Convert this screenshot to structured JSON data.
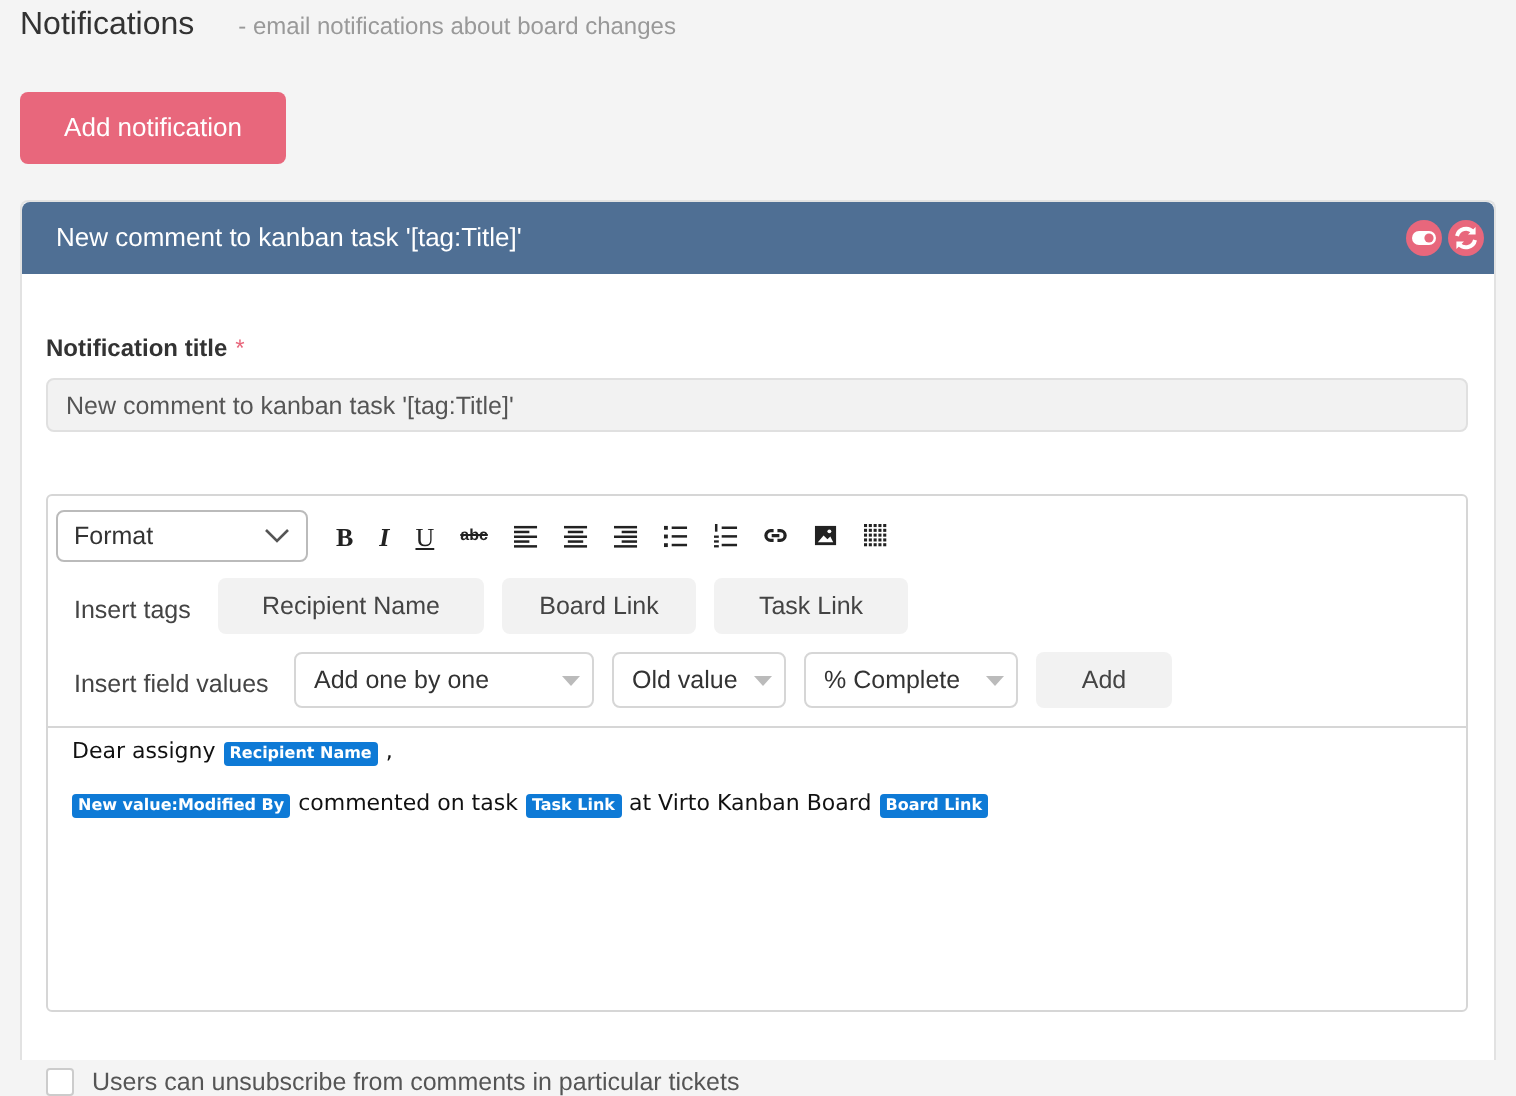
{
  "page": {
    "title": "Notifications",
    "subtitle": "- email notifications about board changes"
  },
  "add_button": "Add notification",
  "panel": {
    "title": "New comment to kanban task '[tag:Title]'",
    "title_field": {
      "label": "Notification title",
      "required_mark": "*",
      "value": "New comment to kanban task '[tag:Title]'"
    },
    "editor": {
      "format_select": "Format",
      "toolbar": [
        {
          "kind": "bold",
          "text": "B"
        },
        {
          "kind": "italic",
          "text": "I"
        },
        {
          "kind": "underline",
          "text": "U"
        },
        {
          "kind": "strike",
          "text": "abc"
        },
        {
          "kind": "align-left"
        },
        {
          "kind": "align-center"
        },
        {
          "kind": "align-right"
        },
        {
          "kind": "bullets"
        },
        {
          "kind": "numbers"
        },
        {
          "kind": "link"
        },
        {
          "kind": "image"
        },
        {
          "kind": "table"
        }
      ],
      "insert_tags": {
        "label": "Insert tags",
        "buttons": [
          "Recipient Name",
          "Board Link",
          "Task Link"
        ]
      },
      "insert_field_values": {
        "label": "Insert field values",
        "selects": [
          "Add one by one",
          "Old value",
          "% Complete"
        ],
        "button": "Add"
      },
      "body": [
        [
          {
            "kind": "text",
            "text": "Dear assigny"
          },
          {
            "kind": "tag",
            "text": "Recipient Name"
          },
          {
            "kind": "text",
            "text": ","
          }
        ],
        [
          {
            "kind": "tag",
            "text": "New value:Modified By"
          },
          {
            "kind": "text",
            "text": "commented on task"
          },
          {
            "kind": "tag",
            "text": "Task Link"
          },
          {
            "kind": "text",
            "text": "at Virto Kanban Board"
          },
          {
            "kind": "tag",
            "text": "Board Link"
          }
        ]
      ]
    },
    "unsubscribe": {
      "label": "Users can unsubscribe from comments in particular tickets",
      "checked": false
    }
  }
}
